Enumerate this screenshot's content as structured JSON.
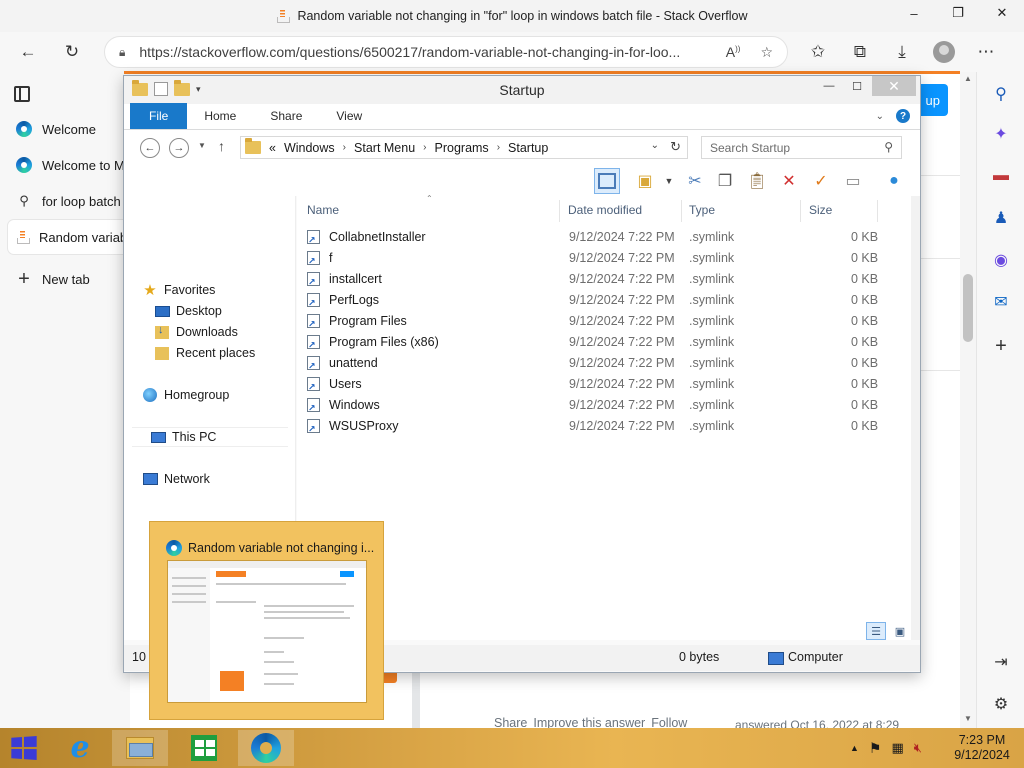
{
  "browser": {
    "title": "Random variable not changing in \"for\" loop in windows batch file - Stack Overflow",
    "url": "https://stackoverflow.com/questions/6500217/random-variable-not-changing-in-for-loo...",
    "controls": {
      "minimize": "–",
      "restore": "❐",
      "close": "✕"
    }
  },
  "tabs": [
    {
      "label": "Welcome",
      "icon": "edge-icon"
    },
    {
      "label": "Welcome to Mi",
      "icon": "edge-icon"
    },
    {
      "label": "for loop batch r",
      "icon": "search-icon"
    },
    {
      "label": "Random variab",
      "icon": "stackoverflow-icon",
      "active": true
    },
    {
      "label": "New tab",
      "icon": "plus-icon"
    }
  ],
  "page": {
    "signup": "up",
    "answer_links": [
      "Share",
      "Improve this answer",
      "Follow"
    ],
    "answered": "answered Oct 16, 2022 at 8:29"
  },
  "explorer": {
    "title": "Startup",
    "ribbon_tabs": [
      "File",
      "Home",
      "Share",
      "View"
    ],
    "breadcrumb": [
      "«",
      "Windows",
      "Start Menu",
      "Programs",
      "Startup"
    ],
    "search_placeholder": "Search Startup",
    "columns": {
      "name": "Name",
      "date": "Date modified",
      "type": "Type",
      "size": "Size"
    },
    "nav": {
      "favorites": "Favorites",
      "desktop": "Desktop",
      "downloads": "Downloads",
      "recent": "Recent places",
      "homegroup": "Homegroup",
      "thispc": "This PC",
      "network": "Network"
    },
    "files": [
      {
        "name": "CollabnetInstaller",
        "date": "9/12/2024 7:22 PM",
        "type": ".symlink",
        "size": "0 KB"
      },
      {
        "name": "f",
        "date": "9/12/2024 7:22 PM",
        "type": ".symlink",
        "size": "0 KB"
      },
      {
        "name": "installcert",
        "date": "9/12/2024 7:22 PM",
        "type": ".symlink",
        "size": "0 KB"
      },
      {
        "name": "PerfLogs",
        "date": "9/12/2024 7:22 PM",
        "type": ".symlink",
        "size": "0 KB"
      },
      {
        "name": "Program Files",
        "date": "9/12/2024 7:22 PM",
        "type": ".symlink",
        "size": "0 KB"
      },
      {
        "name": "Program Files (x86)",
        "date": "9/12/2024 7:22 PM",
        "type": ".symlink",
        "size": "0 KB"
      },
      {
        "name": "unattend",
        "date": "9/12/2024 7:22 PM",
        "type": ".symlink",
        "size": "0 KB"
      },
      {
        "name": "Users",
        "date": "9/12/2024 7:22 PM",
        "type": ".symlink",
        "size": "0 KB"
      },
      {
        "name": "Windows",
        "date": "9/12/2024 7:22 PM",
        "type": ".symlink",
        "size": "0 KB"
      },
      {
        "name": "WSUSProxy",
        "date": "9/12/2024 7:22 PM",
        "type": ".symlink",
        "size": "0 KB"
      }
    ],
    "status": {
      "items": "10 i",
      "bytes": "0 bytes",
      "location": "Computer"
    }
  },
  "thumbnail": {
    "title": "Random variable not changing i..."
  },
  "taskbar": {
    "time": "7:23 PM",
    "date": "9/12/2024"
  }
}
